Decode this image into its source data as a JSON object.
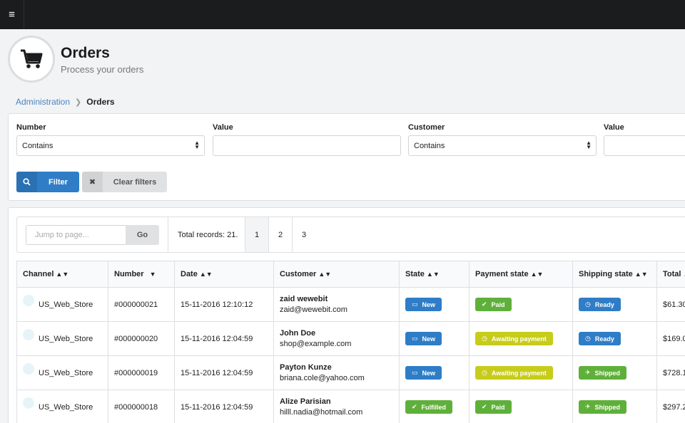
{
  "colors": {
    "topbar": "#1b1c1d",
    "primary": "#2e7dc6",
    "green": "#5fb03a",
    "yellow": "#c7cc1b"
  },
  "header": {
    "title": "Orders",
    "subtitle": "Process your orders",
    "icon": "shopping-cart-icon"
  },
  "breadcrumb": {
    "parent": "Administration",
    "current": "Orders"
  },
  "filters": {
    "number_label": "Number",
    "number_value": "Contains",
    "value_label": "Value",
    "customer_label": "Customer",
    "customer_value": "Contains",
    "value2_label": "Value",
    "filter_button": "Filter",
    "clear_button": "Clear filters"
  },
  "pager": {
    "jump_placeholder": "Jump to page...",
    "go_label": "Go",
    "total": "Total records: 21.",
    "pages": [
      "1",
      "2",
      "3"
    ]
  },
  "table": {
    "columns": [
      "Channel",
      "Number",
      "Date",
      "Customer",
      "State",
      "Payment state",
      "Shipping state",
      "Total"
    ],
    "rows": [
      {
        "channel": "US_Web_Store",
        "number": "#000000021",
        "date": "15-11-2016 12:10:12",
        "name": "zaid wewebit",
        "email": "zaid@wewebit.com",
        "state": "New",
        "payment": "Paid",
        "shipping": "Ready",
        "total": "$61.30"
      },
      {
        "channel": "US_Web_Store",
        "number": "#000000020",
        "date": "15-11-2016 12:04:59",
        "name": "John Doe",
        "email": "shop@example.com",
        "state": "New",
        "payment": "Awaiting payment",
        "shipping": "Ready",
        "total": "$169.0"
      },
      {
        "channel": "US_Web_Store",
        "number": "#000000019",
        "date": "15-11-2016 12:04:59",
        "name": "Payton Kunze",
        "email": "briana.cole@yahoo.com",
        "state": "New",
        "payment": "Awaiting payment",
        "shipping": "Shipped",
        "total": "$728.1"
      },
      {
        "channel": "US_Web_Store",
        "number": "#000000018",
        "date": "15-11-2016 12:04:59",
        "name": "Alize Parisian",
        "email": "hilll.nadia@hotmail.com",
        "state": "Fulfilled",
        "payment": "Paid",
        "shipping": "Shipped",
        "total": "$297.2"
      }
    ]
  }
}
